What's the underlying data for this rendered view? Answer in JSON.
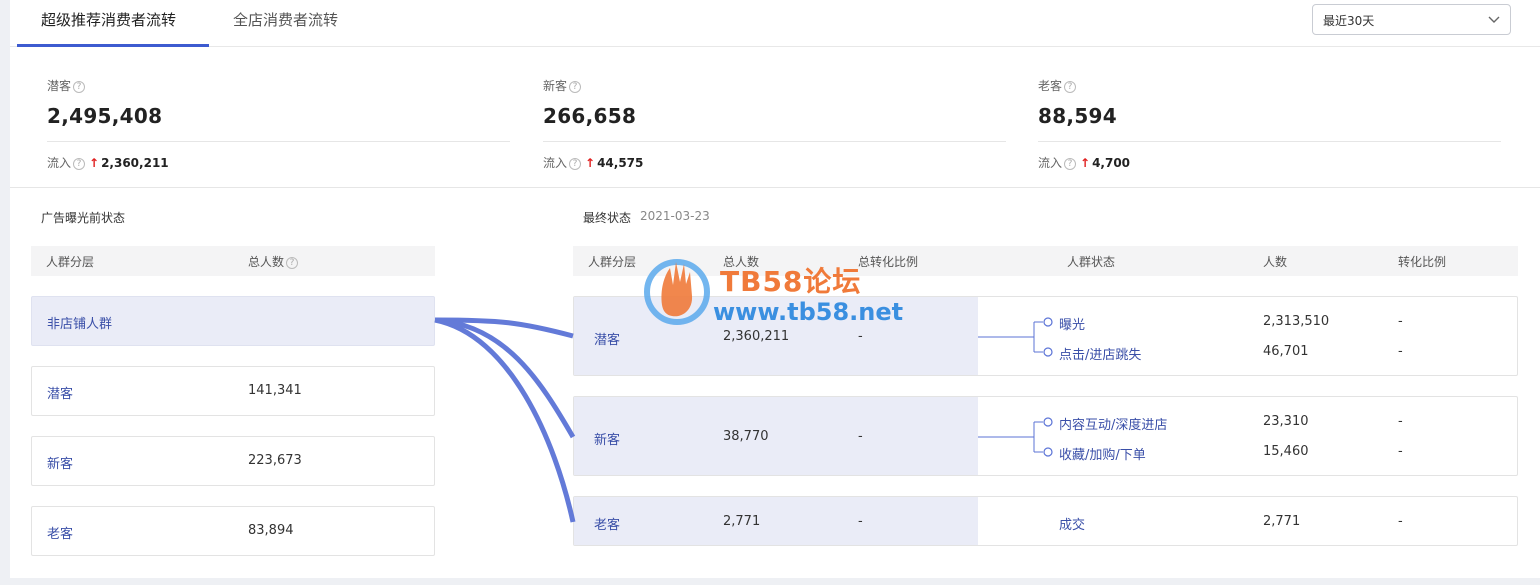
{
  "tabs": [
    {
      "label": "超级推荐消费者流转",
      "active": true
    },
    {
      "label": "全店消费者流转",
      "active": false
    }
  ],
  "period_select": {
    "value": "最近30天"
  },
  "stats": [
    {
      "label": "潜客",
      "value": "2,495,408",
      "flow_label": "流入",
      "flow_value": "2,360,211"
    },
    {
      "label": "新客",
      "value": "266,658",
      "flow_label": "流入",
      "flow_value": "44,575"
    },
    {
      "label": "老客",
      "value": "88,594",
      "flow_label": "流入",
      "flow_value": "4,700"
    }
  ],
  "left_panel": {
    "title": "广告曝光前状态",
    "headers": [
      "人群分层",
      "总人数"
    ],
    "rows": [
      {
        "name": "非店铺人群",
        "count": ""
      },
      {
        "name": "潜客",
        "count": "141,341"
      },
      {
        "name": "新客",
        "count": "223,673"
      },
      {
        "name": "老客",
        "count": "83,894"
      }
    ]
  },
  "right_panel": {
    "title": "最终状态",
    "date": "2021-03-23",
    "headers": [
      "人群分层",
      "总人数",
      "总转化比例",
      "人群状态",
      "人数",
      "转化比例"
    ],
    "rows": [
      {
        "name": "潜客",
        "total": "2,360,211",
        "rate": "-",
        "states": [
          {
            "label": "曝光",
            "count": "2,313,510",
            "rate": "-"
          },
          {
            "label": "点击/进店跳失",
            "count": "46,701",
            "rate": "-"
          }
        ]
      },
      {
        "name": "新客",
        "total": "38,770",
        "rate": "-",
        "states": [
          {
            "label": "内容互动/深度进店",
            "count": "23,310",
            "rate": "-"
          },
          {
            "label": "收藏/加购/下单",
            "count": "15,460",
            "rate": "-"
          }
        ]
      },
      {
        "name": "老客",
        "total": "2,771",
        "rate": "-",
        "states": [
          {
            "label": "成交",
            "count": "2,771",
            "rate": "-"
          }
        ]
      }
    ]
  },
  "watermark": {
    "title": "TB58论坛",
    "url": "www.tb58.net"
  },
  "colors": {
    "accent": "#3d5bd0",
    "link": "#3a4fa8",
    "flow": "#5b73d6",
    "up_arrow": "#e02020"
  },
  "icons": {
    "help": "help-circle-icon",
    "chevron": "chevron-down-icon",
    "up": "arrow-up-icon"
  }
}
